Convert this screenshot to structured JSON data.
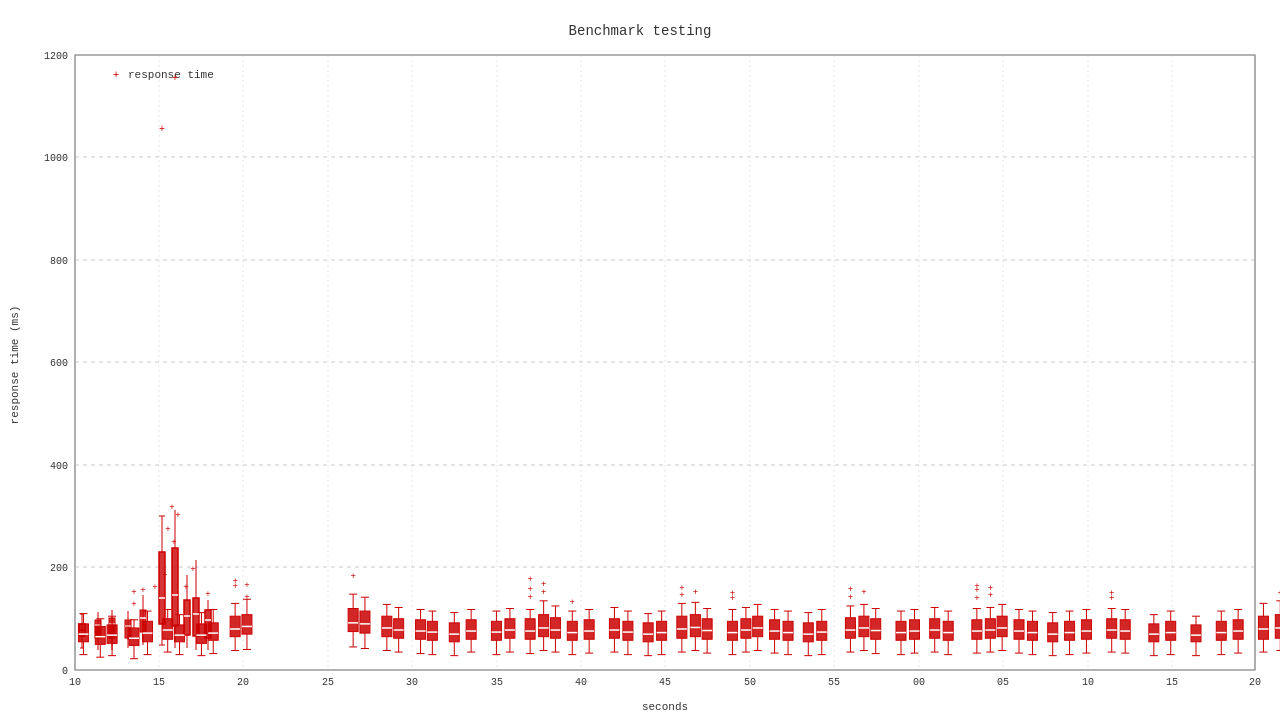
{
  "chart": {
    "title": "Benchmark testing",
    "xAxisLabel": "seconds",
    "yAxisLabel": "response time (ms)",
    "legendLabel": "response time",
    "colors": {
      "data": "#cc0000",
      "grid": "#cccccc",
      "axis": "#333333"
    },
    "xTicks": [
      "10",
      "15",
      "20",
      "25",
      "30",
      "35",
      "40",
      "45",
      "50",
      "55",
      "00",
      "05",
      "10",
      "15",
      "20"
    ],
    "yTicks": [
      "0",
      "200",
      "400",
      "600",
      "800",
      "1000",
      "1200"
    ]
  }
}
